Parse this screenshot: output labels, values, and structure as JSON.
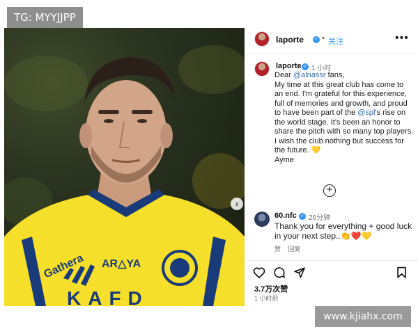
{
  "watermark_top": "TG: MYYJJPP",
  "watermark_bottom": "www.kjiahx.com",
  "photo": {
    "shirt_sponsor": "Gathera",
    "shirt_brand": "AR△YA",
    "shirt_bottom": "KAFD",
    "next_icon": "chevron-right-icon",
    "jersey_color": "#f6df2a",
    "trim_color": "#1a3b7a"
  },
  "header": {
    "username": "laporte",
    "separator": "•",
    "follow_label": "关注",
    "more_label": "•••"
  },
  "post": {
    "username": "laporte",
    "time": "1 小时",
    "caption": {
      "line_greeting_prefix": "Dear ",
      "mention_club": "@alnassr",
      "line_greeting_suffix": " fans,",
      "para1": "My time at this great club has come to an end. I'm grateful for this experience, full of memories and growth, and proud to have been part of the ",
      "mention_league": "@spl",
      "para1_suffix": "'s rise on the world stage. It's been an honor to share the pitch with so many top players. I wish the club nothing but success for the future. 💛",
      "signature": "Ayme"
    }
  },
  "load_more_label": "+",
  "comment": {
    "username": "60.nfc",
    "time": "26分钟",
    "text": "Thank you for everything + good luck in your next step..👏❤️💛",
    "like_label": "赞",
    "reply_label": "回复"
  },
  "actions": {
    "likes": "3.7万次赞",
    "posted": "1 小时前"
  },
  "colors": {
    "link": "#3897f0",
    "verified": "#3897f0",
    "mention": "#3d6ea5"
  }
}
